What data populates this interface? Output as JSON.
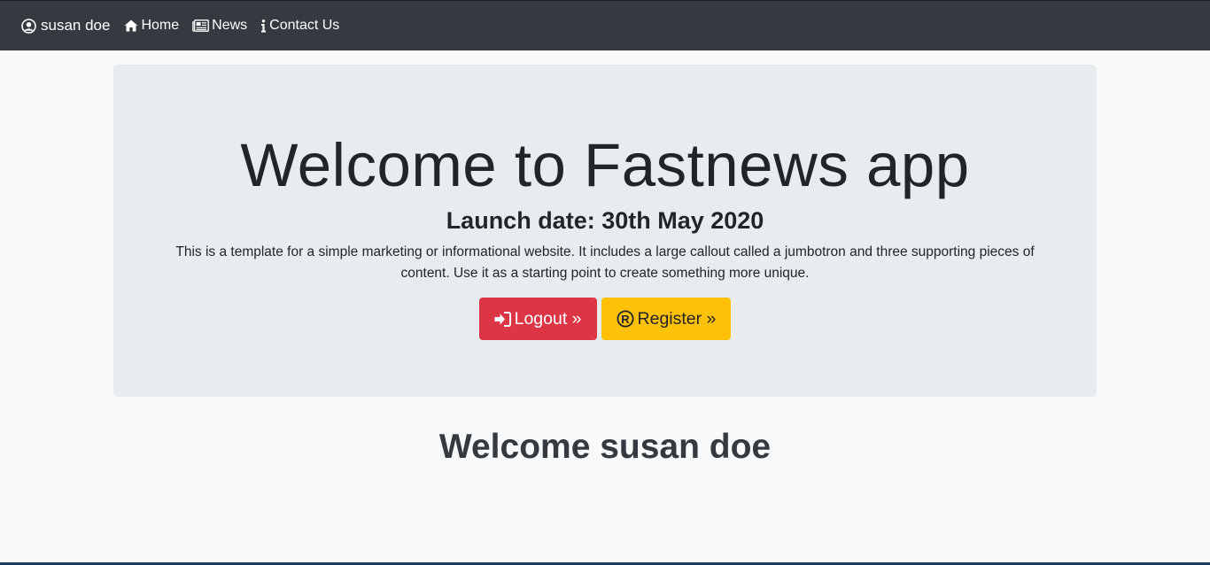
{
  "navbar": {
    "brand_label": "susan doe",
    "brand_icon": "user-circle-icon",
    "links": [
      {
        "label": "Home",
        "icon": "home-icon"
      },
      {
        "label": "News",
        "icon": "newspaper-icon"
      },
      {
        "label": "Contact Us",
        "icon": "info-icon"
      }
    ]
  },
  "jumbotron": {
    "title": "Welcome to Fastnews app",
    "subtitle": "Launch date: 30th May 2020",
    "text": "This is a template for a simple marketing or informational website. It includes a large callout called a jumbotron and three supporting pieces of content. Use it as a starting point to create something more unique.",
    "logout_label": "Logout »",
    "register_label": "Register »"
  },
  "welcome_heading": "Welcome susan doe",
  "colors": {
    "navbar_bg": "#343a40",
    "jumbotron_bg": "#e9ecef",
    "logout_bg": "#dc3545",
    "register_bg": "#ffc107",
    "page_bg": "#f8f9fa"
  }
}
